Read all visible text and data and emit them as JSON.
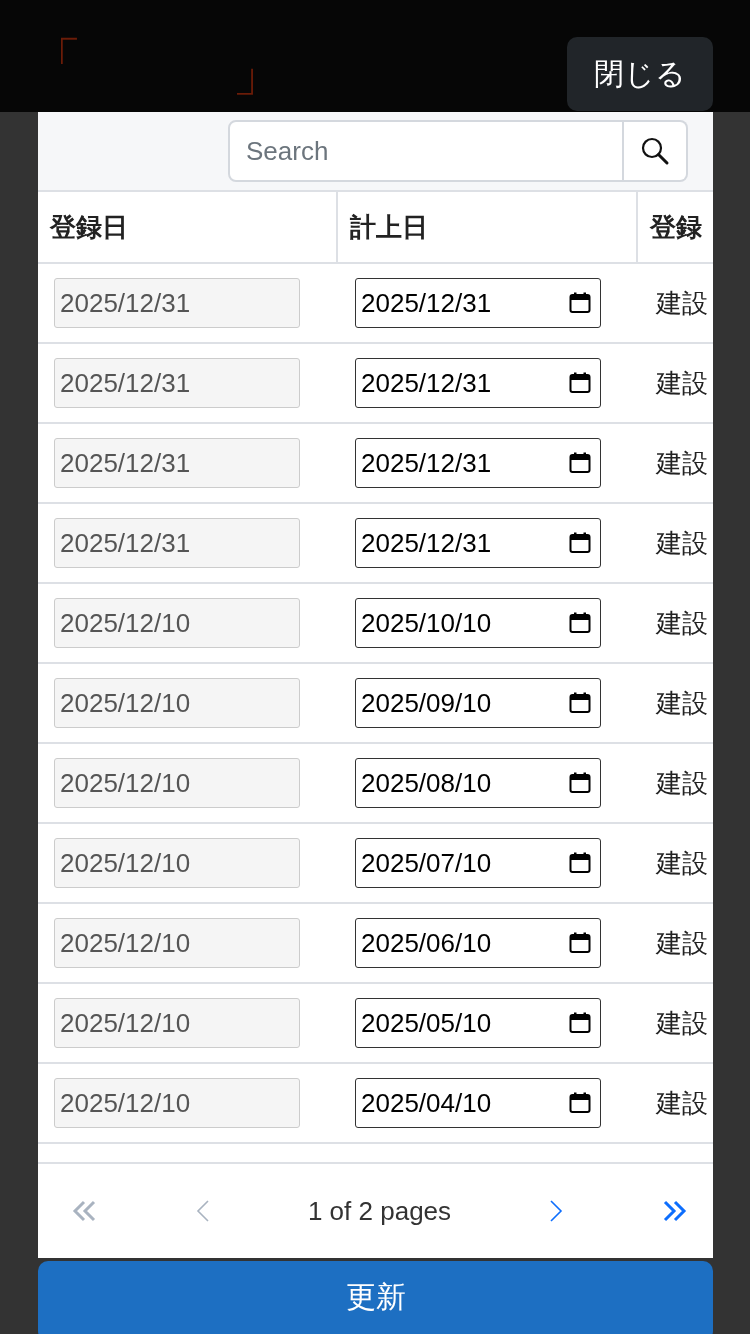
{
  "header": {
    "logo_open": "「",
    "logo_close": "」"
  },
  "close_button": {
    "label": "閉じる"
  },
  "modal": {
    "search": {
      "placeholder": "Search"
    },
    "table": {
      "columns": [
        "登録日",
        "計上日",
        "登録"
      ],
      "rows": [
        {
          "registered": "2025/12/31",
          "recorded": "2025/12/31",
          "registrant": "建設"
        },
        {
          "registered": "2025/12/31",
          "recorded": "2025/12/31",
          "registrant": "建設"
        },
        {
          "registered": "2025/12/31",
          "recorded": "2025/12/31",
          "registrant": "建設"
        },
        {
          "registered": "2025/12/31",
          "recorded": "2025/12/31",
          "registrant": "建設"
        },
        {
          "registered": "2025/12/10",
          "recorded": "2025/10/10",
          "registrant": "建設"
        },
        {
          "registered": "2025/12/10",
          "recorded": "2025/09/10",
          "registrant": "建設"
        },
        {
          "registered": "2025/12/10",
          "recorded": "2025/08/10",
          "registrant": "建設"
        },
        {
          "registered": "2025/12/10",
          "recorded": "2025/07/10",
          "registrant": "建設"
        },
        {
          "registered": "2025/12/10",
          "recorded": "2025/06/10",
          "registrant": "建設"
        },
        {
          "registered": "2025/12/10",
          "recorded": "2025/05/10",
          "registrant": "建設"
        },
        {
          "registered": "2025/12/10",
          "recorded": "2025/04/10",
          "registrant": "建設"
        }
      ]
    },
    "pagination": {
      "first": {
        "disabled": true
      },
      "prev": {
        "disabled": true
      },
      "info": "1 of 2 pages",
      "next": {
        "disabled": false
      },
      "last": {
        "disabled": false
      }
    },
    "update_button": {
      "label": "更新"
    }
  }
}
